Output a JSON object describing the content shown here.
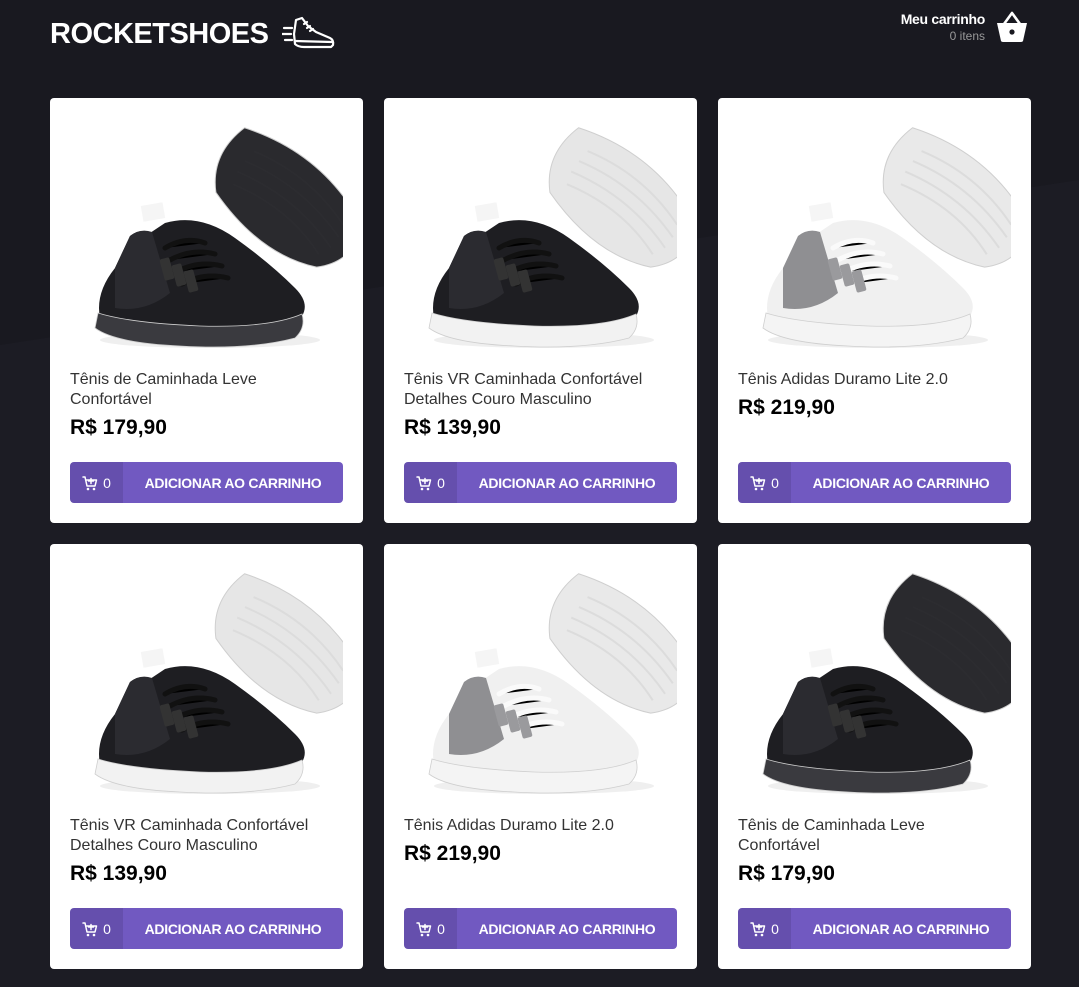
{
  "brand": {
    "name": "ROCKETSHOES",
    "logo_icon": "running-shoe-icon"
  },
  "cart": {
    "title": "Meu carrinho",
    "count": "0 itens",
    "icon": "basket-icon"
  },
  "colors": {
    "background": "#191920",
    "accent": "#7159c1",
    "card": "#ffffff"
  },
  "products": [
    {
      "title": "Tênis de Caminhada Leve Confortável",
      "price": "R$ 179,90",
      "amount": "0",
      "button": "ADICIONAR AO CARRINHO",
      "variant": "black"
    },
    {
      "title": "Tênis VR Caminhada Confortável Detalhes Couro Masculino",
      "price": "R$ 139,90",
      "amount": "0",
      "button": "ADICIONAR AO CARRINHO",
      "variant": "black-white"
    },
    {
      "title": "Tênis Adidas Duramo Lite 2.0",
      "price": "R$ 219,90",
      "amount": "0",
      "button": "ADICIONAR AO CARRINHO",
      "variant": "white-gray"
    },
    {
      "title": "Tênis VR Caminhada Confortável Detalhes Couro Masculino",
      "price": "R$ 139,90",
      "amount": "0",
      "button": "ADICIONAR AO CARRINHO",
      "variant": "black-white"
    },
    {
      "title": "Tênis Adidas Duramo Lite 2.0",
      "price": "R$ 219,90",
      "amount": "0",
      "button": "ADICIONAR AO CARRINHO",
      "variant": "white-gray"
    },
    {
      "title": "Tênis de Caminhada Leve Confortável",
      "price": "R$ 179,90",
      "amount": "0",
      "button": "ADICIONAR AO CARRINHO",
      "variant": "black"
    }
  ]
}
